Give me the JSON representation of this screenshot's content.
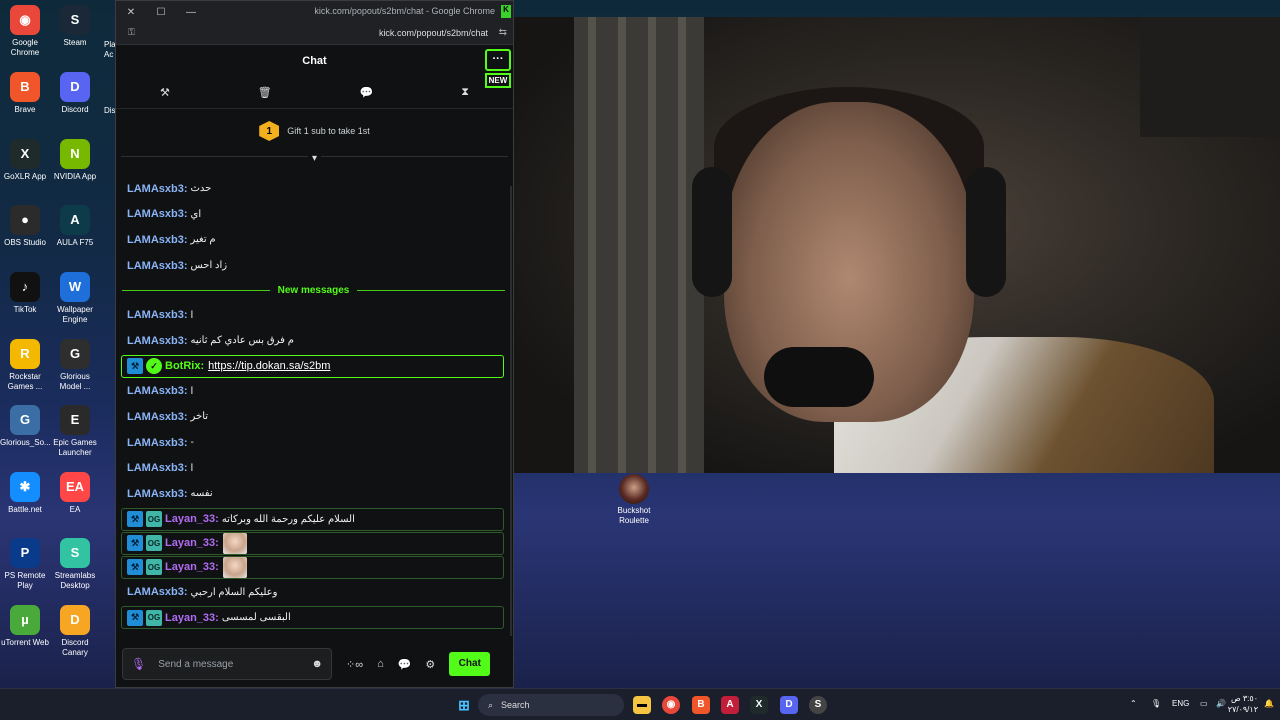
{
  "browser": {
    "title": "kick.com/popout/s2bm/chat - Google Chrome",
    "url": "kick.com/popout/s2bm/chat"
  },
  "chat": {
    "header_title": "Chat",
    "more_label": "···",
    "new_badge": "NEW",
    "pinned": {
      "coin_number": "1",
      "text": "Gift 1 sub to take 1st"
    },
    "new_messages_label": "New messages",
    "messages": [
      {
        "kind": "plain",
        "user": "LAMAsxb3:",
        "text": "حدث"
      },
      {
        "kind": "plain",
        "user": "LAMAsxb3:",
        "text": "اي"
      },
      {
        "kind": "plain",
        "user": "LAMAsxb3:",
        "text": "م تغير"
      },
      {
        "kind": "plain",
        "user": "LAMAsxb3:",
        "text": "زاد احس"
      },
      {
        "kind": "divider"
      },
      {
        "kind": "plain",
        "user": "LAMAsxb3:",
        "text": "ا"
      },
      {
        "kind": "plain",
        "user": "LAMAsxb3:",
        "text": "م فرق بس عادي كم ثانيه"
      },
      {
        "kind": "bot",
        "user": "BotRix:",
        "text": "https://tip.dokan.sa/s2bm"
      },
      {
        "kind": "plain",
        "user": "LAMAsxb3:",
        "text": "ا"
      },
      {
        "kind": "plain",
        "user": "LAMAsxb3:",
        "text": "تاخر"
      },
      {
        "kind": "plain",
        "user": "LAMAsxb3:",
        "text": "-"
      },
      {
        "kind": "plain",
        "user": "LAMAsxb3:",
        "text": "ا"
      },
      {
        "kind": "plain",
        "user": "LAMAsxb3:",
        "text": "نفسه"
      },
      {
        "kind": "layan",
        "user": "Layan_33:",
        "text": "السلام عليكم ورحمة الله وبركاته"
      },
      {
        "kind": "layan-emote",
        "user": "Layan_33:",
        "text": ""
      },
      {
        "kind": "layan-emote",
        "user": "Layan_33:",
        "text": ""
      },
      {
        "kind": "plain",
        "user": "LAMAsxb3:",
        "text": "وعليكم السلام ارحبي"
      },
      {
        "kind": "layan",
        "user": "Layan_33:",
        "text": "البقسى لمسسى"
      }
    ],
    "input_placeholder": "Send a message",
    "infinity_label": "∞",
    "send_label": "Chat"
  },
  "desktop_icons": [
    {
      "label": "Google Chrome",
      "color": "#e9473a",
      "glyph": "◉"
    },
    {
      "label": "Steam",
      "color": "#1b2838",
      "glyph": "S"
    },
    {
      "label": "Brave",
      "color": "#f1562b",
      "glyph": "B"
    },
    {
      "label": "Discord",
      "color": "#5865f2",
      "glyph": "D"
    },
    {
      "label": "GoXLR App",
      "color": "#1f2a2a",
      "glyph": "X"
    },
    {
      "label": "NVIDIA App",
      "color": "#76b900",
      "glyph": "N"
    },
    {
      "label": "OBS Studio",
      "color": "#2b2b2b",
      "glyph": "●"
    },
    {
      "label": "AULA F75",
      "color": "#0e3b4a",
      "glyph": "A"
    },
    {
      "label": "TikTok",
      "color": "#111111",
      "glyph": "♪"
    },
    {
      "label": "Wallpaper Engine",
      "color": "#1e6fd9",
      "glyph": "W"
    },
    {
      "label": "Rockstar Games ...",
      "color": "#f5b800",
      "glyph": "R"
    },
    {
      "label": "Glorious Model ...",
      "color": "#2e2e2e",
      "glyph": "G"
    },
    {
      "label": "Glorious_So...",
      "color": "#3a6ea5",
      "glyph": "G"
    },
    {
      "label": "Epic Games Launcher",
      "color": "#2a2a2a",
      "glyph": "E"
    },
    {
      "label": "Battle.net",
      "color": "#148eff",
      "glyph": "✱"
    },
    {
      "label": "EA",
      "color": "#ff4747",
      "glyph": "EA"
    },
    {
      "label": "PS Remote Play",
      "color": "#0a3a8a",
      "glyph": "P"
    },
    {
      "label": "Streamlabs Desktop",
      "color": "#31c3a2",
      "glyph": "S"
    },
    {
      "label": "uTorrent Web",
      "color": "#4aa93b",
      "glyph": "µ"
    },
    {
      "label": "Discord Canary",
      "color": "#f6a623",
      "glyph": "D"
    }
  ],
  "partial_icon_label": "Pla Ac",
  "partial_icon_label2": "Dis",
  "buckshot_label": "Buckshot Roulette",
  "taskbar": {
    "search_label": "Search",
    "lang": "ENG",
    "time": "٣:٥٠ ص",
    "date": "٢٧/٠٩/١٢"
  }
}
